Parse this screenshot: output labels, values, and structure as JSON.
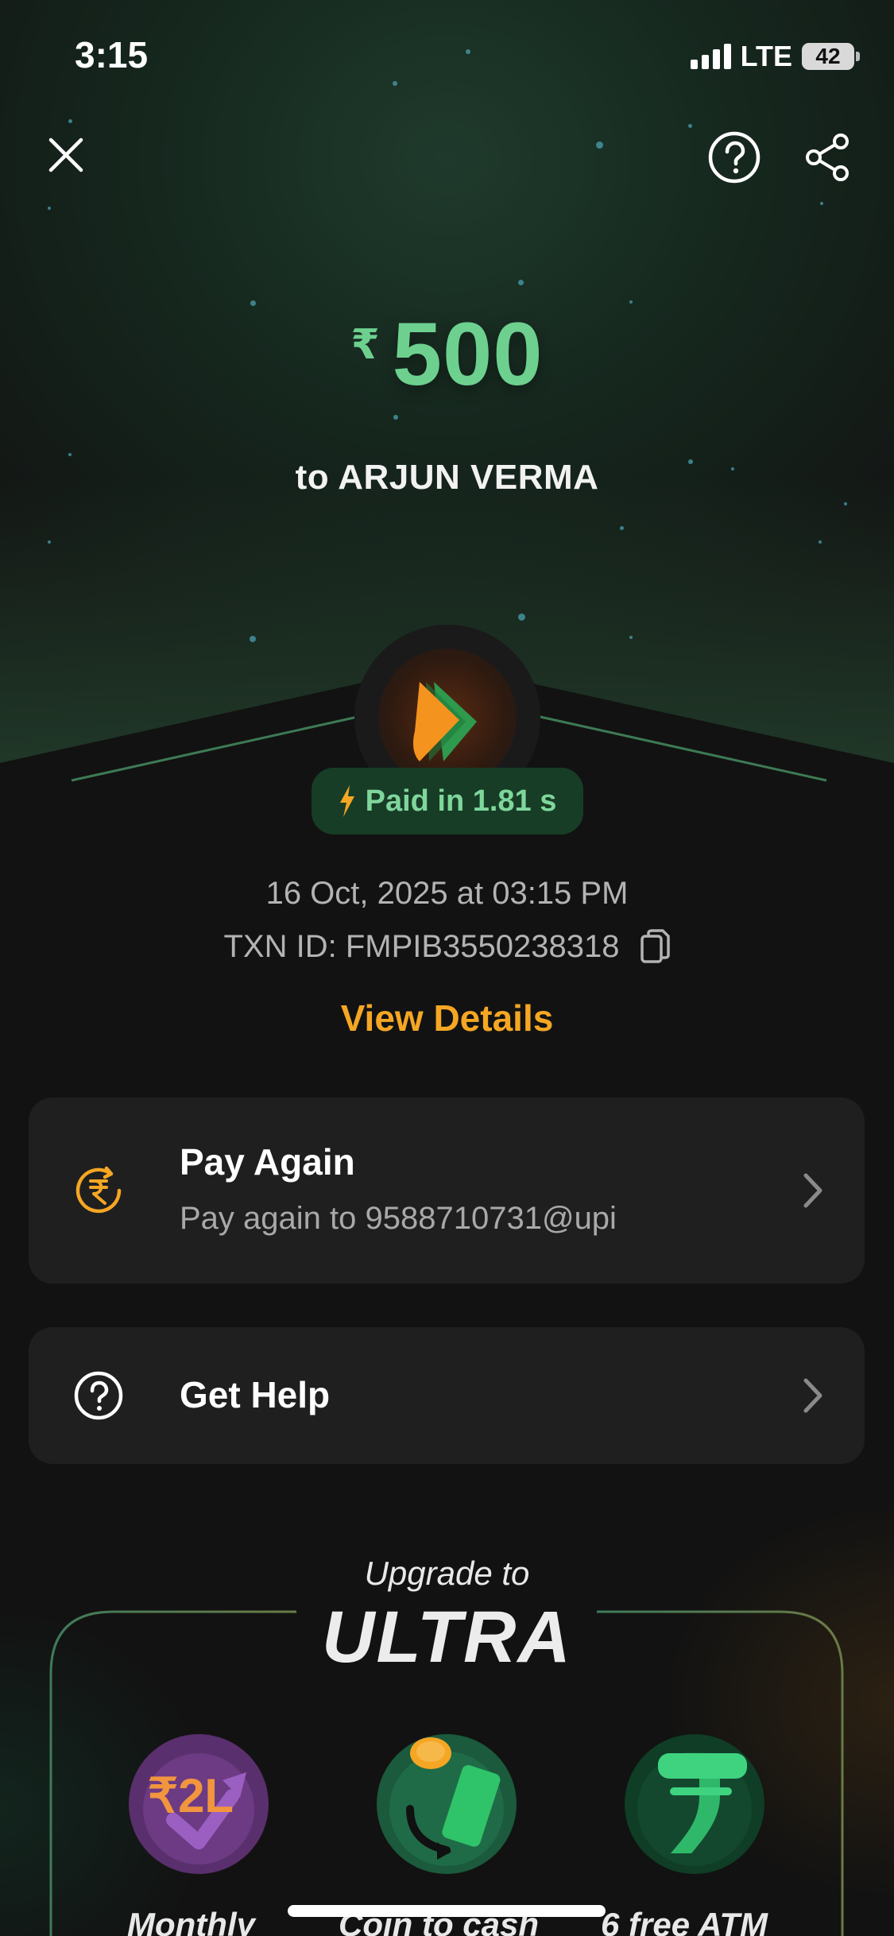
{
  "status_bar": {
    "time": "3:15",
    "network": "LTE",
    "battery": "42"
  },
  "header": {
    "close_icon": "close-icon",
    "help_icon": "help-circle-icon",
    "share_icon": "share-icon"
  },
  "payment": {
    "currency_symbol": "₹",
    "amount": "500",
    "recipient_line": "to ARJUN VERMA",
    "paid_badge": "Paid in 1.81 s",
    "datetime": "16 Oct, 2025 at 03:15 PM",
    "txn_id": "TXN ID: FMPIB3550238318",
    "view_details": "View Details"
  },
  "actions": [
    {
      "title": "Pay Again",
      "subtitle": "Pay again to 9588710731@upi",
      "icon": "rupee-refresh-icon"
    },
    {
      "title": "Get Help",
      "icon": "help-circle-icon"
    }
  ],
  "upgrade": {
    "tagline": "Upgrade to",
    "brand": "ULTRA",
    "benefits": [
      {
        "label": "Monthly",
        "icon": "rupee-2l-badge-icon"
      },
      {
        "label": "Coin to cash",
        "icon": "coin-to-cash-icon"
      },
      {
        "label": "6 free ATM",
        "icon": "atm-rupee-icon"
      }
    ]
  },
  "colors": {
    "amount_green": "#6dd08f",
    "accent_orange": "#f5a623",
    "card_bg": "#1f1f1f",
    "page_bg": "#121212"
  }
}
